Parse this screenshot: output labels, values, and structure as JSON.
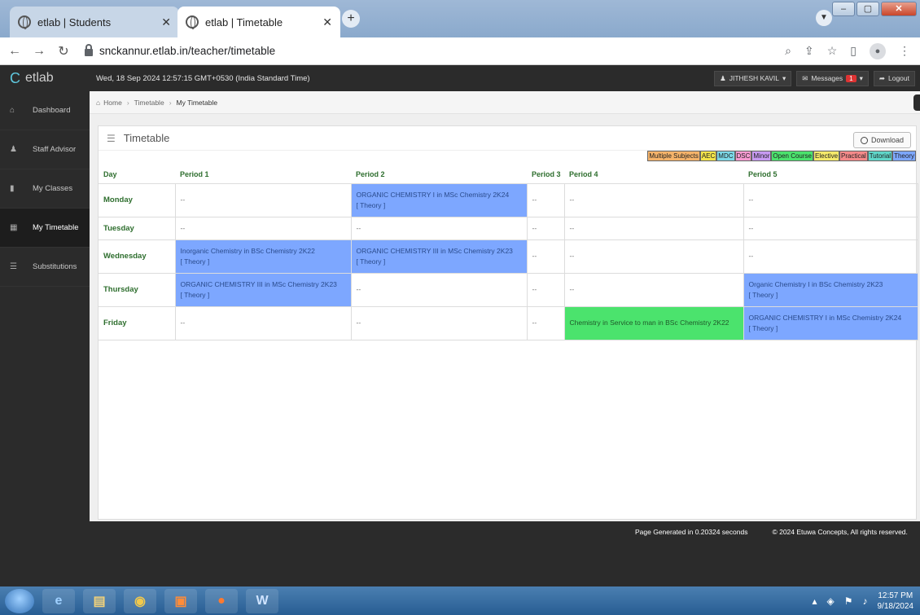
{
  "browser": {
    "tabs": [
      {
        "title": "etlab | Students",
        "active": false
      },
      {
        "title": "etlab | Timetable",
        "active": true
      }
    ],
    "url": "snckannur.etlab.in/teacher/timetable"
  },
  "header": {
    "logo_text": "etlab",
    "datetime": "Wed, 18 Sep 2024   12:57:15 GMT+0530 (India Standard Time)",
    "user": "JITHESH KAVIL",
    "messages_label": "Messages",
    "messages_count": "1",
    "logout_label": "Logout"
  },
  "sidebar": {
    "items": [
      {
        "label": "Dashboard",
        "icon": "home-icon",
        "glyph": "⌂"
      },
      {
        "label": "Staff Advisor",
        "icon": "user-icon",
        "glyph": "♟"
      },
      {
        "label": "My Classes",
        "icon": "book-icon",
        "glyph": "▮"
      },
      {
        "label": "My Timetable",
        "icon": "grid-icon",
        "glyph": "▦"
      },
      {
        "label": "Substitutions",
        "icon": "list-icon",
        "glyph": "☰"
      }
    ]
  },
  "breadcrumb": {
    "home": "Home",
    "timetable": "Timetable",
    "current": "My Timetable"
  },
  "panel": {
    "title": "Timetable",
    "download_label": "Download"
  },
  "legend": [
    {
      "label": "Multiple Subjects",
      "color": "#f5b36a"
    },
    {
      "label": "AEC",
      "color": "#f2e34a"
    },
    {
      "label": "MDC",
      "color": "#7cd7e6"
    },
    {
      "label": "DSC",
      "color": "#f59ad0"
    },
    {
      "label": "Minor",
      "color": "#c79af2"
    },
    {
      "label": "Open Course",
      "color": "#4be36d"
    },
    {
      "label": "Elective",
      "color": "#f4e96a"
    },
    {
      "label": "Practical",
      "color": "#f58a8a"
    },
    {
      "label": "Tutorial",
      "color": "#5fd6c9"
    },
    {
      "label": "Theory",
      "color": "#7da7ff"
    }
  ],
  "timetable": {
    "headers": [
      "Day",
      "Period 1",
      "Period 2",
      "Period 3",
      "Period 4",
      "Period 5"
    ],
    "rows": [
      {
        "day": "Monday",
        "cells": [
          {
            "text": "--",
            "sub": "",
            "kind": ""
          },
          {
            "text": "ORGANIC CHEMISTRY I in MSc Chemistry 2K24",
            "sub": "[ Theory ]",
            "kind": "theory"
          },
          {
            "text": "--",
            "sub": "",
            "kind": ""
          },
          {
            "text": "--",
            "sub": "",
            "kind": ""
          },
          {
            "text": "--",
            "sub": "",
            "kind": ""
          }
        ]
      },
      {
        "day": "Tuesday",
        "cells": [
          {
            "text": "--",
            "sub": "",
            "kind": ""
          },
          {
            "text": "--",
            "sub": "",
            "kind": ""
          },
          {
            "text": "--",
            "sub": "",
            "kind": ""
          },
          {
            "text": "--",
            "sub": "",
            "kind": ""
          },
          {
            "text": "--",
            "sub": "",
            "kind": ""
          }
        ]
      },
      {
        "day": "Wednesday",
        "cells": [
          {
            "text": "Inorganic Chemistry in BSc Chemistry 2K22",
            "sub": "[ Theory ]",
            "kind": "theory"
          },
          {
            "text": "ORGANIC CHEMISTRY III in MSc Chemistry 2K23",
            "sub": "[ Theory ]",
            "kind": "theory"
          },
          {
            "text": "--",
            "sub": "",
            "kind": ""
          },
          {
            "text": "--",
            "sub": "",
            "kind": ""
          },
          {
            "text": "--",
            "sub": "",
            "kind": ""
          }
        ]
      },
      {
        "day": "Thursday",
        "cells": [
          {
            "text": "ORGANIC CHEMISTRY III in MSc Chemistry 2K23",
            "sub": "[ Theory ]",
            "kind": "theory"
          },
          {
            "text": "--",
            "sub": "",
            "kind": ""
          },
          {
            "text": "--",
            "sub": "",
            "kind": ""
          },
          {
            "text": "--",
            "sub": "",
            "kind": ""
          },
          {
            "text": "Organic Chemistry I in BSc Chemistry 2K23",
            "sub": "[ Theory ]",
            "kind": "theory"
          }
        ]
      },
      {
        "day": "Friday",
        "cells": [
          {
            "text": "--",
            "sub": "",
            "kind": ""
          },
          {
            "text": "--",
            "sub": "",
            "kind": ""
          },
          {
            "text": "--",
            "sub": "",
            "kind": ""
          },
          {
            "text": "Chemistry in Service to man in BSc Chemistry 2K22",
            "sub": "",
            "kind": "open"
          },
          {
            "text": "ORGANIC CHEMISTRY I in MSc Chemistry 2K24",
            "sub": "[ Theory ]",
            "kind": "theory"
          }
        ]
      }
    ]
  },
  "footer": {
    "generated": "Page Generated in 0.20324 seconds",
    "copyright": "© 2024 Etuwa Concepts, All rights reserved."
  },
  "taskbar": {
    "time": "12:57 PM",
    "date": "9/18/2024"
  }
}
